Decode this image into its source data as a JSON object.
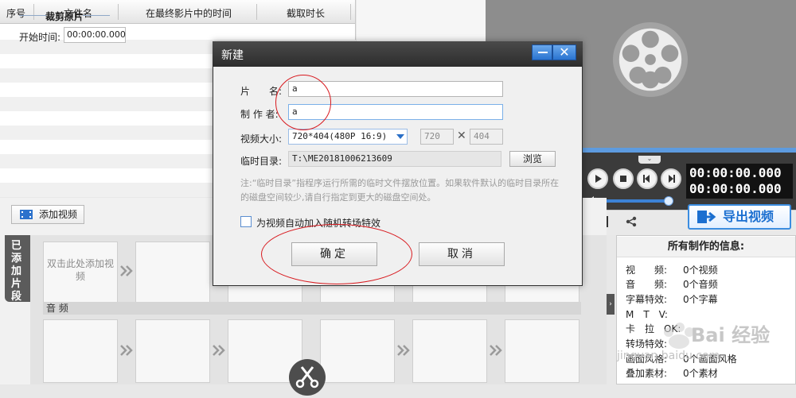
{
  "clip_table": {
    "columns": [
      "序号",
      "文件名",
      "在最终影片中的时间",
      "截取时长"
    ]
  },
  "crop_panel": {
    "title": "裁剪原片",
    "start_label": "开始时间:",
    "start_value": "00:00:00.000"
  },
  "player": {
    "timecode_current": "00:00:00.000",
    "timecode_total": "00:00:00.000",
    "volume": 0.9,
    "export_label": "导出视频",
    "help_label": "?"
  },
  "info_panel": {
    "title": "所有制作的信息:",
    "rows": [
      {
        "key": "视　　频:",
        "value": "0个视频"
      },
      {
        "key": "音　　频:",
        "value": "0个音频"
      },
      {
        "key": "字幕特效:",
        "value": "0个字幕"
      },
      {
        "key": "M　T　V:",
        "value": ""
      },
      {
        "key": "卡　拉　OK:",
        "value": ""
      },
      {
        "key": "转场特效:",
        "value": ""
      },
      {
        "key": "画面风格:",
        "value": "0个画面风格"
      },
      {
        "key": "叠加素材:",
        "value": "0个素材"
      }
    ]
  },
  "timeline": {
    "add_video_label": "添加视频",
    "added_clips_tab": "已添加片段",
    "empty_slot_text": "双击此处添加视频",
    "audio_label": "音 频"
  },
  "dialog": {
    "title": "新建",
    "close_glyph": "✕",
    "name_label": "片　　名:",
    "name_value": "a",
    "author_label": "制 作 者:",
    "author_value": "a",
    "size_label": "视频大小:",
    "size_value": "720*404(480P 16:9)",
    "width_value": "720",
    "height_value": "404",
    "times_sign": "✕",
    "temp_dir_label": "临时目录:",
    "temp_dir_value": "T:\\ME20181006213609",
    "browse_label": "浏览",
    "note": "注:“临时目录”指程序运行所需的临时文件摆放位置。如果软件默认的临时目录所在的磁盘空间较少,请自行指定到更大的磁盘空间处。",
    "transition_checkbox_label": "为视频自动加入随机转场特效",
    "transition_checked": false,
    "ok_label": "确定",
    "cancel_label": "取消"
  },
  "watermark": {
    "text": "Bai 经验",
    "sub": "jingyan.baidu.com"
  },
  "colors": {
    "accent_blue": "#3b8de0",
    "annotation_red": "#d8191e",
    "dialog_title_bg": "#2d2d2d",
    "player_bg": "#8d8d8d"
  }
}
